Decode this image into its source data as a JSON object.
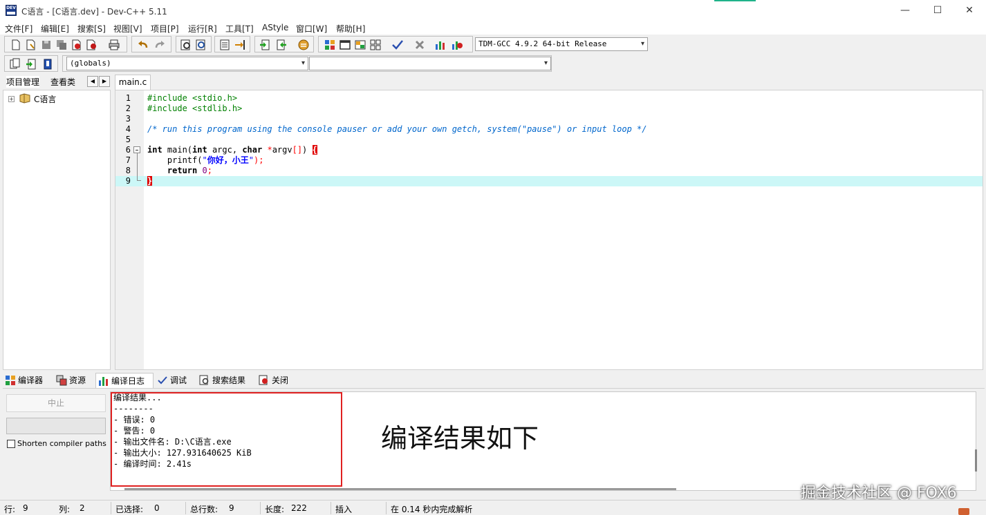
{
  "window": {
    "title": "C语言 - [C语言.dev] - Dev-C++ 5.11",
    "minimize": "—",
    "maximize": "☐",
    "close": "✕"
  },
  "menu": [
    "文件[F]",
    "编辑[E]",
    "搜索[S]",
    "视图[V]",
    "项目[P]",
    "运行[R]",
    "工具[T]",
    "AStyle",
    "窗口[W]",
    "帮助[H]"
  ],
  "toolbar": {
    "compiler_select": "TDM-GCC 4.9.2 64-bit Release",
    "scope_select": "(globals)",
    "function_select": ""
  },
  "left_panel": {
    "tabs": [
      "项目管理",
      "查看类"
    ],
    "tree_root": "C语言"
  },
  "editor": {
    "tab": "main.c",
    "active_line": 9
  },
  "bottom_tabs": [
    "编译器",
    "资源",
    "编译日志",
    "调试",
    "搜索结果",
    "关闭"
  ],
  "compile_panel": {
    "stop_button": "中止",
    "progress": 0,
    "shorten_paths_label": "Shorten compiler paths",
    "shorten_paths_checked": false,
    "log": [
      "编译结果...",
      "--------",
      "- 错误: 0",
      "- 警告: 0",
      "- 输出文件名: D:\\C语言.exe",
      "- 输出大小: 127.931640625 KiB",
      "- 编译时间: 2.41s"
    ]
  },
  "annotation": "编译结果如下",
  "watermark": "掘金技术社区 @ FOX6",
  "status": {
    "row_label": "行:",
    "row_value": "9",
    "col_label": "列:",
    "col_value": "2",
    "sel_label": "已选择:",
    "sel_value": "0",
    "lines_label": "总行数:",
    "lines_value": "9",
    "len_label": "长度:",
    "len_value": "222",
    "mode": "插入",
    "parse_msg": "在 0.14 秒内完成解析"
  }
}
